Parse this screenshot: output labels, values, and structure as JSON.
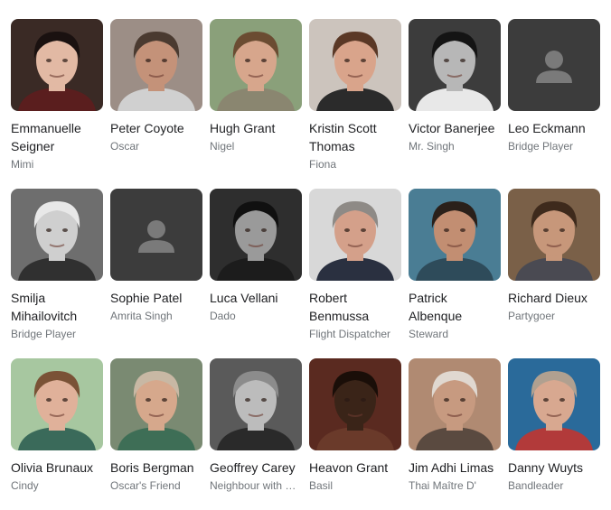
{
  "cast": [
    {
      "name": "Emmanuelle Seigner",
      "role": "Mimi",
      "bg": "#3a2a25",
      "skin": "#e2b9a4",
      "hair": "#1a1110",
      "cloth": "#5a1e1e",
      "placeholder": false
    },
    {
      "name": "Peter Coyote",
      "role": "Oscar",
      "bg": "#9c8e86",
      "skin": "#c49279",
      "hair": "#4a3a30",
      "cloth": "#d0d0d0",
      "placeholder": false
    },
    {
      "name": "Hugh Grant",
      "role": "Nigel",
      "bg": "#8aa07a",
      "skin": "#d7a68c",
      "hair": "#6b4c32",
      "cloth": "#8a8670",
      "placeholder": false
    },
    {
      "name": "Kristin Scott Thomas",
      "role": "Fiona",
      "bg": "#ccc4bd",
      "skin": "#d9a48b",
      "hair": "#5a3826",
      "cloth": "#2b2b2b",
      "placeholder": false
    },
    {
      "name": "Victor Banerjee",
      "role": "Mr. Singh",
      "bg": "#3c3c3c",
      "skin": "#b7b7b7",
      "hair": "#141414",
      "cloth": "#e8e8e8",
      "placeholder": false
    },
    {
      "name": "Leo Eckmann",
      "role": "Bridge Player",
      "placeholder": true
    },
    {
      "name": "Smilja Mihailovitch",
      "role": "Bridge Player",
      "bg": "#6e6e6e",
      "skin": "#cfcfcf",
      "hair": "#e8e8e8",
      "cloth": "#303030",
      "placeholder": false
    },
    {
      "name": "Sophie Patel",
      "role": "Amrita Singh",
      "placeholder": true
    },
    {
      "name": "Luca Vellani",
      "role": "Dado",
      "bg": "#2e2e2e",
      "skin": "#9a9a9a",
      "hair": "#101010",
      "cloth": "#1c1c1c",
      "placeholder": false
    },
    {
      "name": "Robert Benmussa",
      "role": "Flight Dispatcher",
      "bg": "#d8d8d8",
      "skin": "#d4a08a",
      "hair": "#8e8a86",
      "cloth": "#2a3040",
      "placeholder": false
    },
    {
      "name": "Patrick Albenque",
      "role": "Steward",
      "bg": "#4a7d94",
      "skin": "#c28e72",
      "hair": "#2a201a",
      "cloth": "#2e4b5a",
      "placeholder": false
    },
    {
      "name": "Richard Dieux",
      "role": "Partygoer",
      "bg": "#7a6048",
      "skin": "#c7977a",
      "hair": "#3e2a1c",
      "cloth": "#4a4a52",
      "placeholder": false
    },
    {
      "name": "Olivia Brunaux",
      "role": "Cindy",
      "bg": "#a7c7a0",
      "skin": "#e0b19a",
      "hair": "#7a5236",
      "cloth": "#3a6a5a",
      "placeholder": false
    },
    {
      "name": "Boris Bergman",
      "role": "Oscar's Friend",
      "bg": "#7a8a72",
      "skin": "#d6a88c",
      "hair": "#c8b8a4",
      "cloth": "#3e6e56",
      "placeholder": false
    },
    {
      "name": "Geoffrey Carey",
      "role": "Neighbour with …",
      "bg": "#5a5a5a",
      "skin": "#bcbcbc",
      "hair": "#8c8c8c",
      "cloth": "#2a2a2a",
      "placeholder": false
    },
    {
      "name": "Heavon Grant",
      "role": "Basil",
      "bg": "#5a2a20",
      "skin": "#3a2418",
      "hair": "#1a0e08",
      "cloth": "#6a3a2a",
      "placeholder": false
    },
    {
      "name": "Jim Adhi Limas",
      "role": "Thai Maître D'",
      "bg": "#b08a72",
      "skin": "#c79a80",
      "hair": "#e0d8d0",
      "cloth": "#5a4a40",
      "placeholder": false
    },
    {
      "name": "Danny Wuyts",
      "role": "Bandleader",
      "bg": "#2a6a9a",
      "skin": "#d8a890",
      "hair": "#b0a090",
      "cloth": "#b23a3a",
      "placeholder": false
    }
  ]
}
